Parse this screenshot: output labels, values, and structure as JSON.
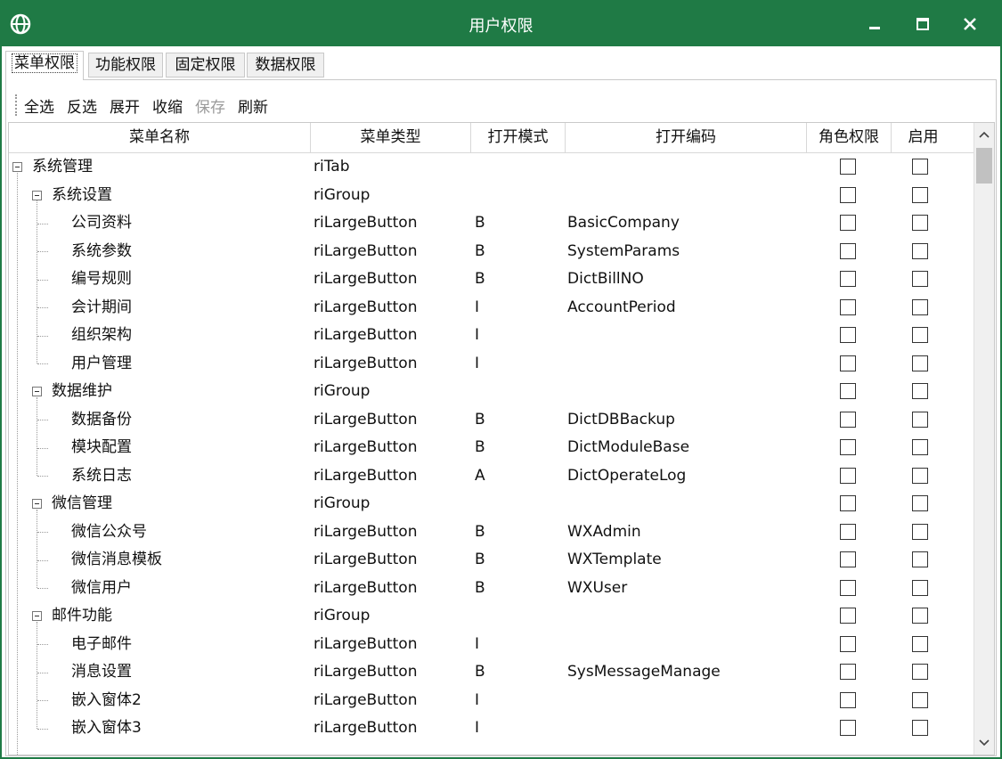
{
  "window": {
    "title": "用户权限",
    "icon": "globe-icon",
    "controls": [
      "minimize-icon",
      "maximize-icon",
      "close-icon"
    ],
    "accent": "#1f7a45"
  },
  "tabs": [
    {
      "label": "菜单权限",
      "active": true
    },
    {
      "label": "功能权限",
      "active": false
    },
    {
      "label": "固定权限",
      "active": false
    },
    {
      "label": "数据权限",
      "active": false
    }
  ],
  "toolbar": [
    {
      "label": "全选",
      "enabled": true
    },
    {
      "label": "反选",
      "enabled": true
    },
    {
      "label": "展开",
      "enabled": true
    },
    {
      "label": "收缩",
      "enabled": true
    },
    {
      "label": "保存",
      "enabled": false
    },
    {
      "label": "刷新",
      "enabled": true
    }
  ],
  "columns": [
    "菜单名称",
    "菜单类型",
    "打开模式",
    "打开编码",
    "角色权限",
    "启用"
  ],
  "rows": [
    {
      "name": "系统管理",
      "level": 0,
      "expanded": true,
      "type": "riTab",
      "mode": "",
      "code": "",
      "role": false,
      "enabled": false
    },
    {
      "name": "系统设置",
      "level": 1,
      "expanded": true,
      "type": "riGroup",
      "mode": "",
      "code": "",
      "role": false,
      "enabled": false
    },
    {
      "name": "公司资料",
      "level": 2,
      "type": "riLargeButton",
      "mode": "B",
      "code": "BasicCompany",
      "role": false,
      "enabled": false
    },
    {
      "name": "系统参数",
      "level": 2,
      "type": "riLargeButton",
      "mode": "B",
      "code": "SystemParams",
      "role": false,
      "enabled": false
    },
    {
      "name": "编号规则",
      "level": 2,
      "type": "riLargeButton",
      "mode": "B",
      "code": "DictBillNO",
      "role": false,
      "enabled": false
    },
    {
      "name": "会计期间",
      "level": 2,
      "type": "riLargeButton",
      "mode": "I",
      "code": "AccountPeriod",
      "role": false,
      "enabled": false
    },
    {
      "name": "组织架构",
      "level": 2,
      "type": "riLargeButton",
      "mode": "I",
      "code": "",
      "role": false,
      "enabled": false
    },
    {
      "name": "用户管理",
      "level": 2,
      "type": "riLargeButton",
      "mode": "I",
      "code": "",
      "role": false,
      "enabled": false
    },
    {
      "name": "数据维护",
      "level": 1,
      "expanded": true,
      "type": "riGroup",
      "mode": "",
      "code": "",
      "role": false,
      "enabled": false
    },
    {
      "name": "数据备份",
      "level": 2,
      "type": "riLargeButton",
      "mode": "B",
      "code": "DictDBBackup",
      "role": false,
      "enabled": false
    },
    {
      "name": "模块配置",
      "level": 2,
      "type": "riLargeButton",
      "mode": "B",
      "code": "DictModuleBase",
      "role": false,
      "enabled": false
    },
    {
      "name": "系统日志",
      "level": 2,
      "type": "riLargeButton",
      "mode": "A",
      "code": "DictOperateLog",
      "role": false,
      "enabled": false
    },
    {
      "name": "微信管理",
      "level": 1,
      "expanded": true,
      "type": "riGroup",
      "mode": "",
      "code": "",
      "role": false,
      "enabled": false
    },
    {
      "name": "微信公众号",
      "level": 2,
      "type": "riLargeButton",
      "mode": "B",
      "code": "WXAdmin",
      "role": false,
      "enabled": false
    },
    {
      "name": "微信消息模板",
      "level": 2,
      "type": "riLargeButton",
      "mode": "B",
      "code": "WXTemplate",
      "role": false,
      "enabled": false
    },
    {
      "name": "微信用户",
      "level": 2,
      "type": "riLargeButton",
      "mode": "B",
      "code": "WXUser",
      "role": false,
      "enabled": false
    },
    {
      "name": "邮件功能",
      "level": 1,
      "expanded": true,
      "type": "riGroup",
      "mode": "",
      "code": "",
      "role": false,
      "enabled": false
    },
    {
      "name": "电子邮件",
      "level": 2,
      "type": "riLargeButton",
      "mode": "I",
      "code": "",
      "role": false,
      "enabled": false
    },
    {
      "name": "消息设置",
      "level": 2,
      "type": "riLargeButton",
      "mode": "B",
      "code": "SysMessageManage",
      "role": false,
      "enabled": false
    },
    {
      "name": "嵌入窗体2",
      "level": 2,
      "type": "riLargeButton",
      "mode": "I",
      "code": "",
      "role": false,
      "enabled": false
    },
    {
      "name": "嵌入窗体3",
      "level": 2,
      "type": "riLargeButton",
      "mode": "I",
      "code": "",
      "role": false,
      "enabled": false
    }
  ]
}
